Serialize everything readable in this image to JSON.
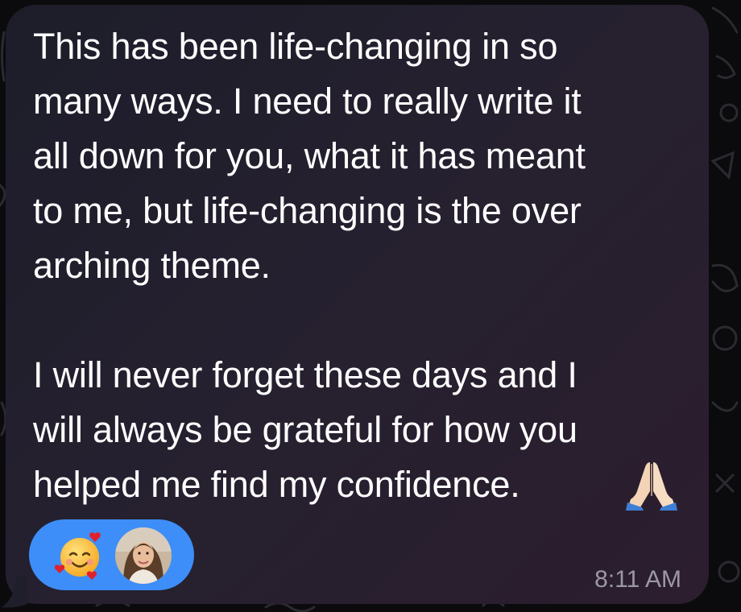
{
  "message": {
    "lines": [
      "This has been life-changing in so",
      "many ways. I need to really write it",
      "all down for you, what it has meant",
      "to me, but life-changing is the over",
      "arching theme.",
      "",
      "I will never forget these days and I",
      "will always be grateful for how you",
      "helped me find my confidence."
    ],
    "trailing_emoji": "folded-hands-icon",
    "timestamp": "8:11 AM"
  },
  "reaction": {
    "emoji": "smiling-face-with-hearts-icon",
    "reactor": "avatar",
    "pill_color": "#3d8ef8"
  },
  "colors": {
    "text": "#ffffff",
    "timestamp": "#9b98a3",
    "bubble_start": "#1d1d2a",
    "bubble_end": "#2c1e2e"
  }
}
